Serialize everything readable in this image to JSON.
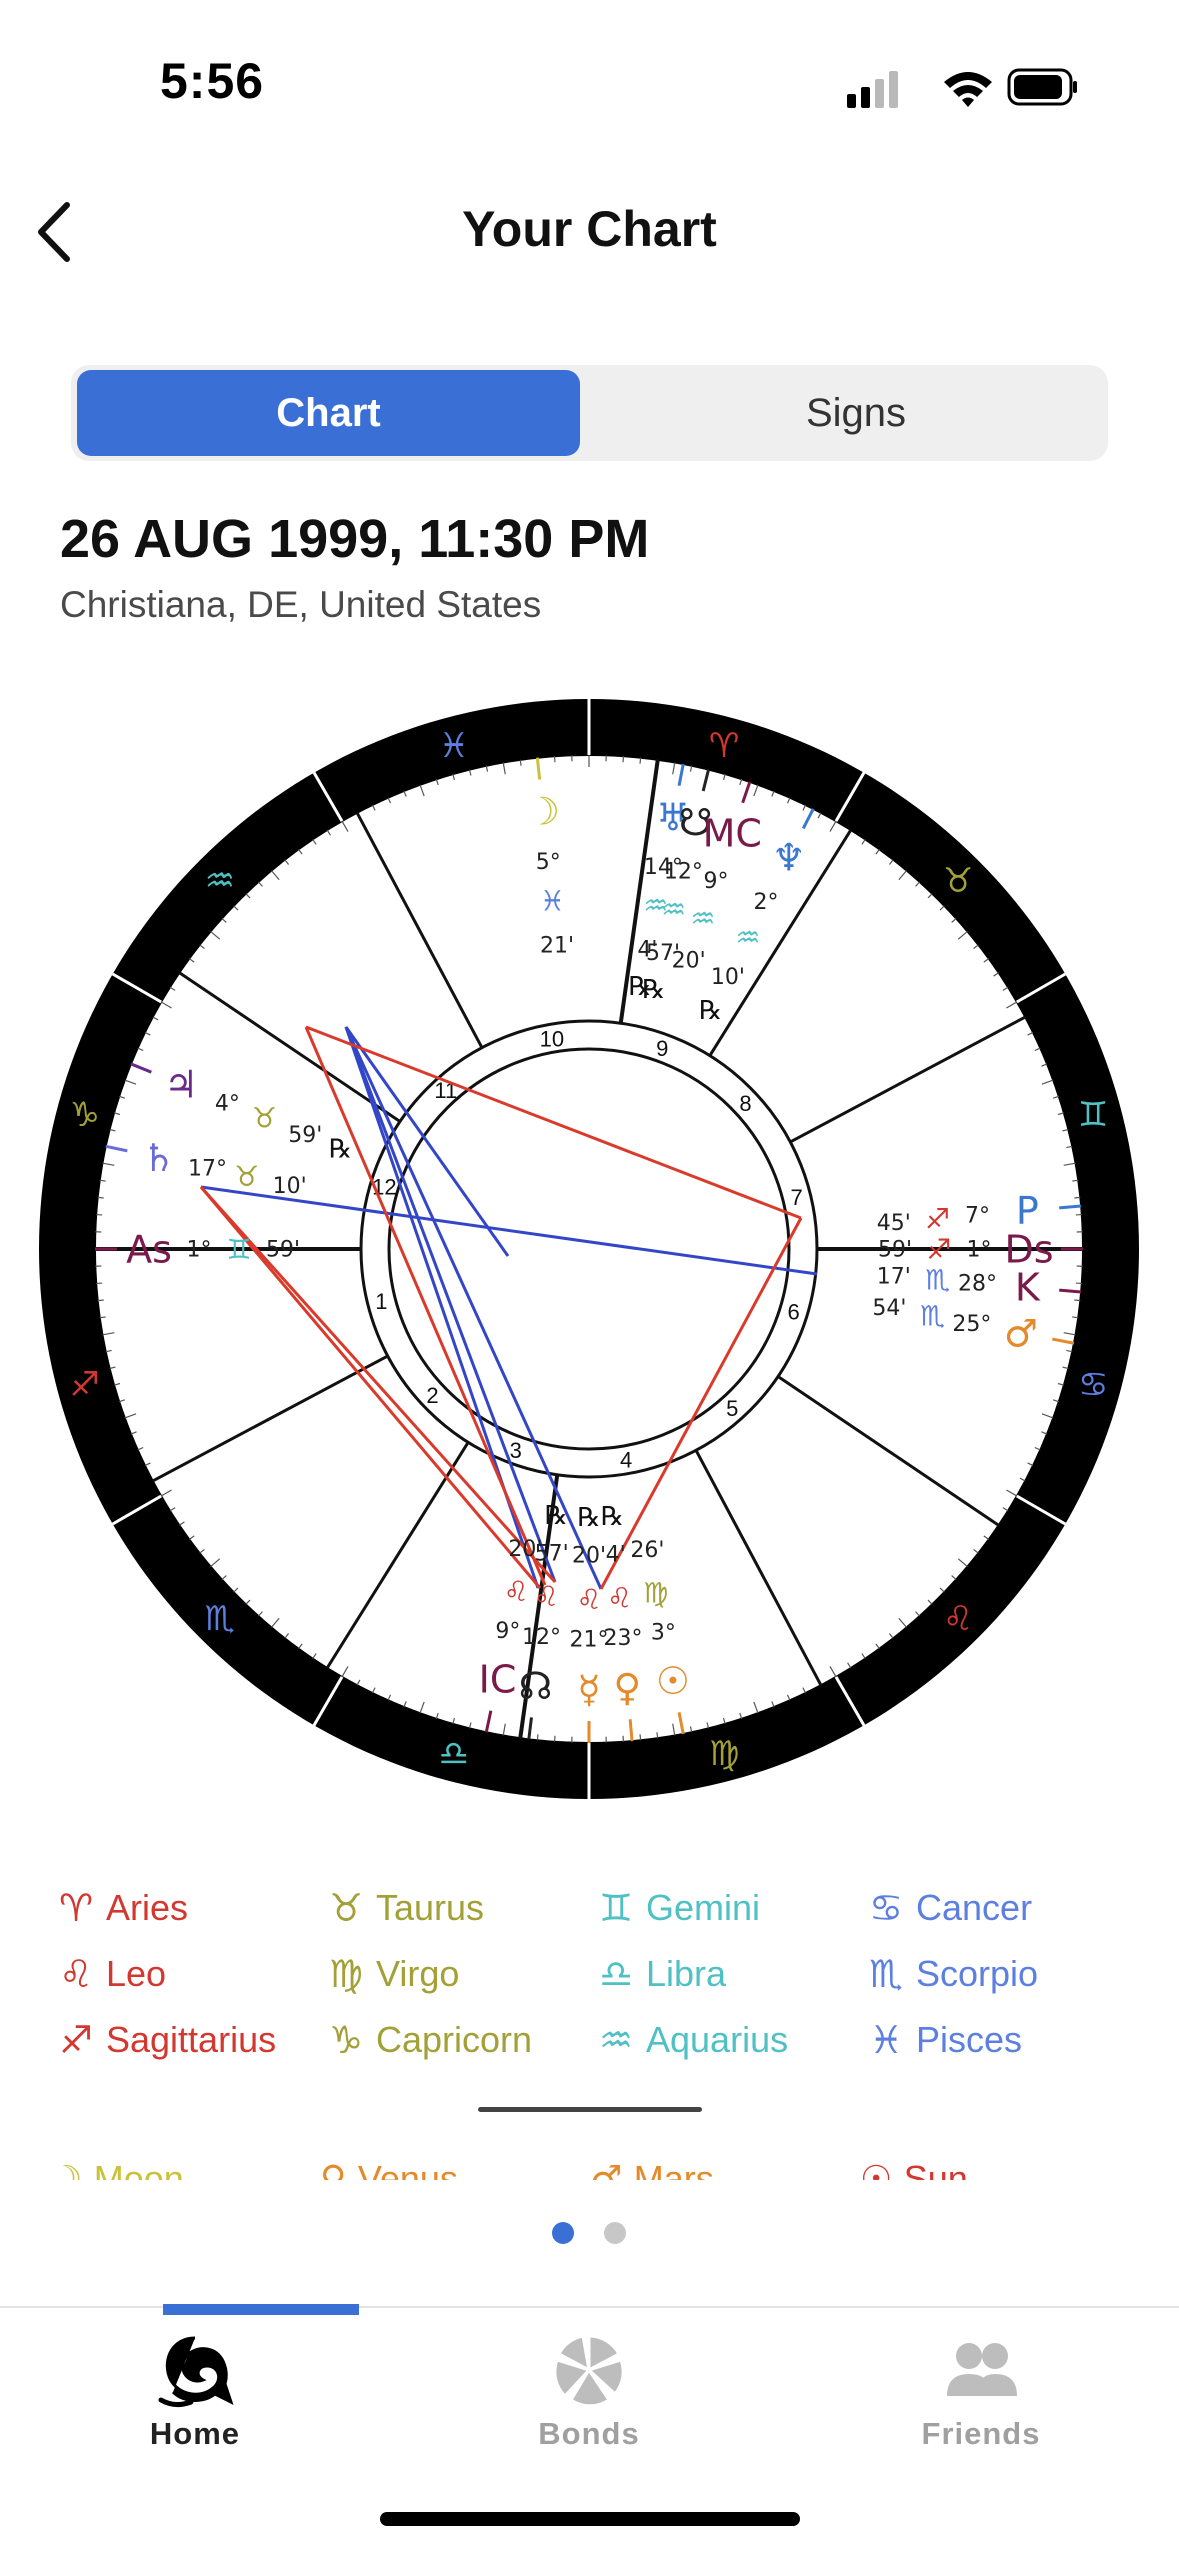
{
  "status_bar": {
    "time": "5:56",
    "icons": [
      "cellular-signal-icon",
      "wifi-icon",
      "battery-icon"
    ]
  },
  "header": {
    "title": "Your Chart",
    "back_icon": "chevron-left-icon"
  },
  "tabs": [
    {
      "label": "Chart",
      "selected": true
    },
    {
      "label": "Signs",
      "selected": false
    }
  ],
  "birth": {
    "date_time": "26 AUG 1999, 11:30 PM",
    "place": "Christiana, DE, United States"
  },
  "chart": {
    "ring_signs": [
      {
        "glyph": "♓",
        "color": "#5c7fe0"
      },
      {
        "glyph": "♒",
        "color": "#4fc0c4"
      },
      {
        "glyph": "♑",
        "color": "#a2a036"
      },
      {
        "glyph": "♐",
        "color": "#d2382f"
      },
      {
        "glyph": "♏",
        "color": "#5c7fe0"
      },
      {
        "glyph": "♎",
        "color": "#4fc0c4"
      },
      {
        "glyph": "♍",
        "color": "#a2a036"
      },
      {
        "glyph": "♌",
        "color": "#d2382f"
      },
      {
        "glyph": "♋",
        "color": "#5c7fe0"
      },
      {
        "glyph": "♊",
        "color": "#4fc0c4"
      },
      {
        "glyph": "♉",
        "color": "#a2a036"
      },
      {
        "glyph": "♈",
        "color": "#d2382f"
      }
    ],
    "house_numbers": [
      "1",
      "2",
      "3",
      "4",
      "5",
      "6",
      "7",
      "8",
      "9",
      "10",
      "11",
      "12"
    ],
    "retrograde_marker": "℞",
    "placements": [
      {
        "name": "moon",
        "glyph": "☽",
        "color": "#c9c23a",
        "degree": "5°",
        "sign_glyph": "♓",
        "sign_color": "#5c7fe0",
        "minutes": "21'"
      },
      {
        "name": "uranus",
        "glyph": "♅",
        "color": "#3a78d0",
        "degree": "14°",
        "sign_glyph": "♒",
        "sign_color": "#4fc0c4",
        "minutes": "4'",
        "retro": true
      },
      {
        "name": "south-node",
        "glyph": "☋",
        "color": "#222222",
        "degree": "12°",
        "sign_glyph": "♒",
        "sign_color": "#4fc0c4",
        "minutes": "57'",
        "retro": true
      },
      {
        "name": "midheaven",
        "glyph": "MC",
        "color": "#7a1a4a",
        "degree": "9°",
        "sign_glyph": "♒",
        "sign_color": "#4fc0c4",
        "minutes": "20'"
      },
      {
        "name": "neptune",
        "glyph": "♆",
        "color": "#3a78d0",
        "degree": "2°",
        "sign_glyph": "♒",
        "sign_color": "#4fc0c4",
        "minutes": "10'",
        "retro": true
      },
      {
        "name": "jupiter",
        "glyph": "♃",
        "color": "#6a2a8a",
        "degree": "4°",
        "sign_glyph": "♉",
        "sign_color": "#a2a036",
        "minutes": "59'",
        "retro": true
      },
      {
        "name": "saturn",
        "glyph": "♄",
        "color": "#6a6ad8",
        "degree": "17°",
        "sign_glyph": "♉",
        "sign_color": "#a2a036",
        "minutes": "10'"
      },
      {
        "name": "ascendant",
        "glyph": "As",
        "color": "#7a1a4a",
        "degree": "1°",
        "sign_glyph": "♊",
        "sign_color": "#4fc0c4",
        "minutes": "59'"
      },
      {
        "name": "pluto",
        "glyph": "P",
        "color": "#3a78d0",
        "degree": "7°",
        "sign_glyph": "♐",
        "sign_color": "#d2382f",
        "minutes": "45'"
      },
      {
        "name": "descendant",
        "glyph": "Ds",
        "color": "#7a1a4a",
        "degree": "1°",
        "sign_glyph": "♐",
        "sign_color": "#d2382f",
        "minutes": "59'"
      },
      {
        "name": "chiron",
        "glyph": "K",
        "color": "#7a1a4a",
        "degree": "28°",
        "sign_glyph": "♏",
        "sign_color": "#5c7fe0",
        "minutes": "17'"
      },
      {
        "name": "mars",
        "glyph": "♂",
        "color": "#e58a2a",
        "degree": "25°",
        "sign_glyph": "♏",
        "sign_color": "#5c7fe0",
        "minutes": "54'"
      },
      {
        "name": "imum-coeli",
        "glyph": "IC",
        "color": "#7a1a4a",
        "degree": "9°",
        "sign_glyph": "♌",
        "sign_color": "#d2382f",
        "minutes": "20'"
      },
      {
        "name": "north-node",
        "glyph": "☊",
        "color": "#222222",
        "degree": "12°",
        "sign_glyph": "♌",
        "sign_color": "#d2382f",
        "minutes": "57'",
        "retro": true
      },
      {
        "name": "mercury",
        "glyph": "☿",
        "color": "#e58a2a",
        "degree": "21°",
        "sign_glyph": "♌",
        "sign_color": "#d2382f",
        "minutes": "20'",
        "retro": true
      },
      {
        "name": "venus",
        "glyph": "♀",
        "color": "#e58a2a",
        "degree": "23°",
        "sign_glyph": "♌",
        "sign_color": "#d2382f",
        "minutes": "4'",
        "retro": true
      },
      {
        "name": "sun",
        "glyph": "☉",
        "color": "#e58a2a",
        "degree": "3°",
        "sign_glyph": "♍",
        "sign_color": "#a2a036",
        "minutes": "26'"
      }
    ],
    "aspect_colors": {
      "trine": "#3346c8",
      "square": "#d93a2b"
    }
  },
  "legend": {
    "signs": [
      {
        "glyph": "♈",
        "label": "Aries",
        "color": "#d2382f"
      },
      {
        "glyph": "♉",
        "label": "Taurus",
        "color": "#a2a036"
      },
      {
        "glyph": "♊",
        "label": "Gemini",
        "color": "#4fc0c4"
      },
      {
        "glyph": "♋",
        "label": "Cancer",
        "color": "#5c7fe0"
      },
      {
        "glyph": "♌",
        "label": "Leo",
        "color": "#d2382f"
      },
      {
        "glyph": "♍",
        "label": "Virgo",
        "color": "#a2a036"
      },
      {
        "glyph": "♎",
        "label": "Libra",
        "color": "#4fc0c4"
      },
      {
        "glyph": "♏",
        "label": "Scorpio",
        "color": "#5c7fe0"
      },
      {
        "glyph": "♐",
        "label": "Sagittarius",
        "color": "#d2382f"
      },
      {
        "glyph": "♑",
        "label": "Capricorn",
        "color": "#a2a036"
      },
      {
        "glyph": "♒",
        "label": "Aquarius",
        "color": "#4fc0c4"
      },
      {
        "glyph": "♓",
        "label": "Pisces",
        "color": "#5c7fe0"
      }
    ],
    "planets_partial": [
      {
        "glyph": "☽",
        "label": "Moon",
        "color": "#c9c23a"
      },
      {
        "glyph": "♀",
        "label": "Venus",
        "color": "#e58a2a"
      },
      {
        "glyph": "♂",
        "label": "Mars",
        "color": "#e58a2a"
      },
      {
        "glyph": "☉",
        "label": "Sun",
        "color": "#d2382f"
      }
    ]
  },
  "pager": {
    "pages": 2,
    "current": 1
  },
  "tab_bar": {
    "items": [
      {
        "label": "Home",
        "icon": "home-swirl-icon",
        "active": true
      },
      {
        "label": "Bonds",
        "icon": "bonds-icon",
        "active": false
      },
      {
        "label": "Friends",
        "icon": "friends-icon",
        "active": false
      }
    ],
    "active_color": "#3a70d6",
    "active_text": "#222222",
    "inactive_text": "#a0a0a0"
  }
}
